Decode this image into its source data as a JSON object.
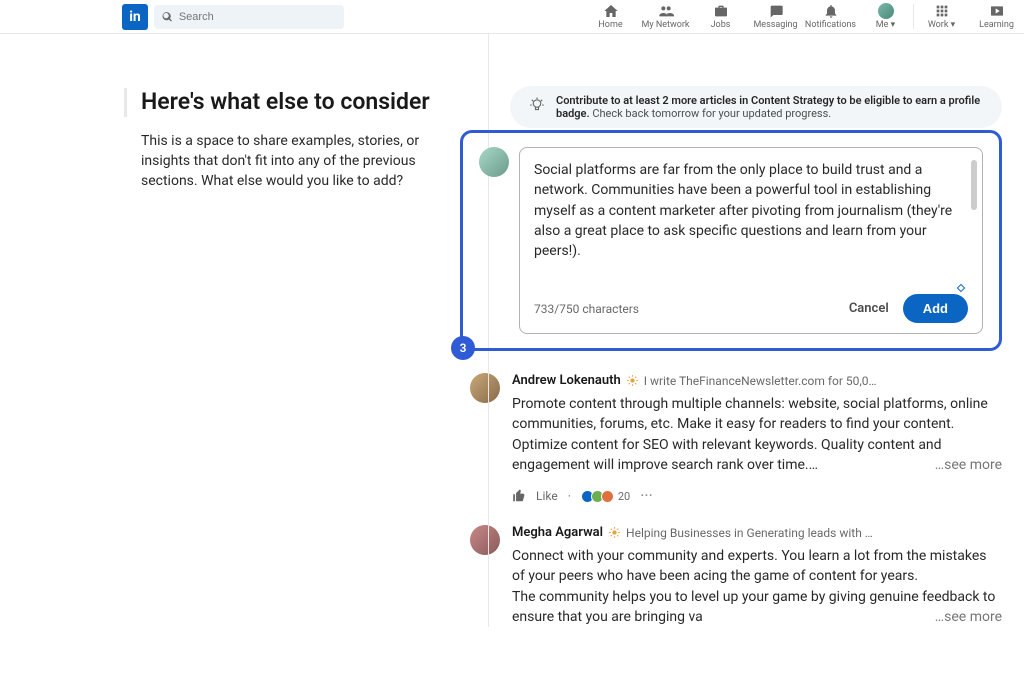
{
  "nav": {
    "logo": "in",
    "search_placeholder": "Search",
    "items": [
      {
        "label": "Home"
      },
      {
        "label": "My Network"
      },
      {
        "label": "Jobs"
      },
      {
        "label": "Messaging"
      },
      {
        "label": "Notifications"
      },
      {
        "label": "Me ▾"
      },
      {
        "label": "Work ▾"
      },
      {
        "label": "Learning"
      }
    ]
  },
  "left": {
    "title": "Here's what else to consider",
    "sub": "This is a space to share examples, stories, or insights that don't fit into any of the previous sections. What else would you like to add?"
  },
  "tip": {
    "bold": "Contribute to at least 2 more articles in Content Strategy to be eligible to earn a profile badge.",
    "rest": " Check back tomorrow for your updated progress."
  },
  "compose": {
    "text": "Social platforms are far from the only place to build trust and a network. Communities have been a powerful tool in establishing myself as a content marketer after pivoting from journalism (they're also a great place to ask specific questions and learn from your peers!).",
    "counter": "733/750 characters",
    "cancel": "Cancel",
    "add": "Add",
    "badge": "3"
  },
  "posts": [
    {
      "author": "Andrew Lokenauth",
      "tagline": "I write TheFinanceNewsletter.com for 50,0…",
      "text": "Promote content through multiple channels: website, social platforms, online communities, forums, etc. Make it easy for readers to find your content. Optimize content for SEO with relevant keywords. Quality content and engagement will improve search rank over time.…",
      "seemore": "…see more",
      "like": "Like",
      "reactions": "20"
    },
    {
      "author": "Megha Agarwal",
      "tagline": "Helping Businesses in Generating leads with …",
      "text": "Connect with your community and experts. You learn a lot from the mistakes of your peers who have been acing the game of content for years.\nThe community helps you to level up your game by giving genuine feedback to ensure that you are bringing va",
      "seemore": "…see more"
    }
  ]
}
